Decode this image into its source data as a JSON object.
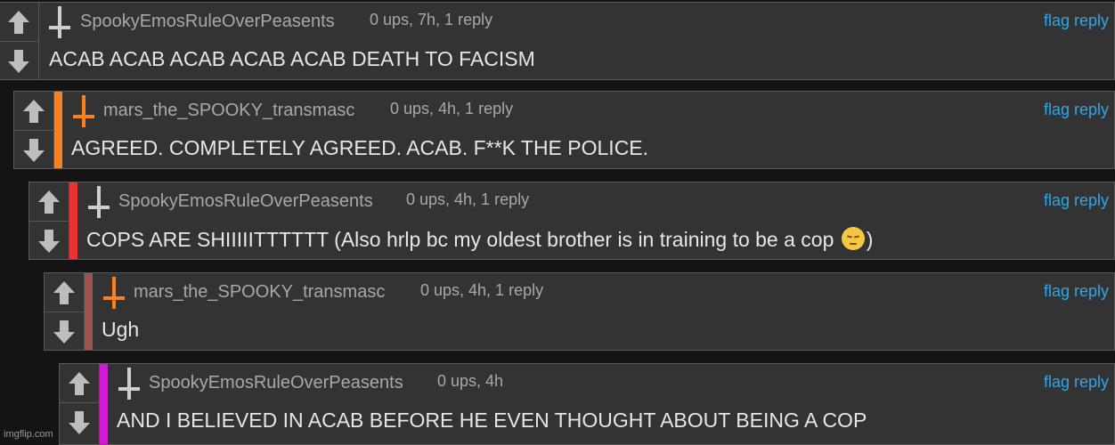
{
  "comments": [
    {
      "username": "SpookyEmosRuleOverPeasents",
      "meta": "0 ups, 7h, 1 reply",
      "flag": "flag",
      "reply": "reply",
      "text": "ACAB ACAB ACAB ACAB ACAB DEATH TO FACISM",
      "icon": "cross-icon",
      "icon_color": "#cfcfcf",
      "bar_color": ""
    },
    {
      "username": "mars_the_SPOOKY_transmasc",
      "meta": "0 ups, 4h, 1 reply",
      "flag": "flag",
      "reply": "reply",
      "text": "AGREED. COMPLETELY AGREED. ACAB. F**K THE POLICE.",
      "icon": "cross-icon",
      "icon_color": "#ff7f1a",
      "bar_color": "#ff7f1a"
    },
    {
      "username": "SpookyEmosRuleOverPeasents",
      "meta": "0 ups, 4h, 1 reply",
      "flag": "flag",
      "reply": "reply",
      "text_before": "COPS ARE SHIIIIITTTTTT (Also hrlp bc my oldest brother is in training to be a cop ",
      "text_after": ")",
      "emoji": "pensive-face-emoji",
      "icon": "cross-icon",
      "icon_color": "#cfcfcf",
      "bar_color": "#ea3232"
    },
    {
      "username": "mars_the_SPOOKY_transmasc",
      "meta": "0 ups, 4h, 1 reply",
      "flag": "flag",
      "reply": "reply",
      "text": "Ugh",
      "icon": "cross-icon",
      "icon_color": "#ff7f1a",
      "bar_color": "#a0524f"
    },
    {
      "username": "SpookyEmosRuleOverPeasents",
      "meta": "0 ups, 4h",
      "flag": "flag",
      "reply": "reply",
      "text": "AND I BELIEVED IN ACAB BEFORE HE EVEN THOUGHT ABOUT BEING A COP",
      "icon": "cross-icon",
      "icon_color": "#cfcfcf",
      "bar_color": "#d21ad6"
    }
  ],
  "watermark": "imgflip.com"
}
